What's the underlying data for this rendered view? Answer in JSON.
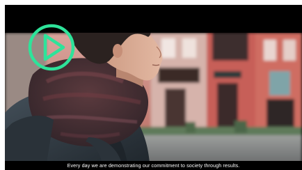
{
  "video": {
    "subtitle": "Every day we are demonstrating our commitment to society through results."
  },
  "controls": {
    "play_icon": "play-icon",
    "accent_color": "#2ee39a"
  },
  "colors": {
    "letterbox": "#000000",
    "building_pink": "#c9716a",
    "building_red": "#c0504a"
  }
}
